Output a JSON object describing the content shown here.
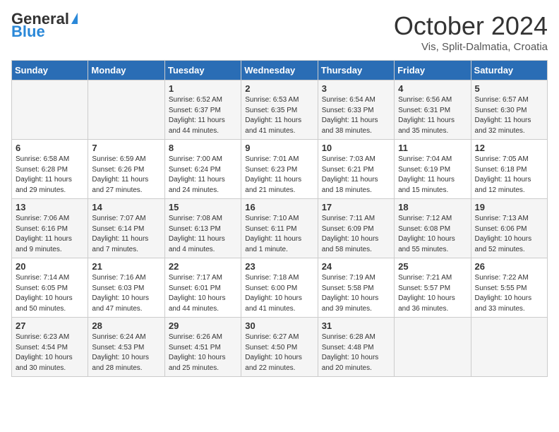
{
  "header": {
    "logo_general": "General",
    "logo_blue": "Blue",
    "month_title": "October 2024",
    "location": "Vis, Split-Dalmatia, Croatia"
  },
  "weekdays": [
    "Sunday",
    "Monday",
    "Tuesday",
    "Wednesday",
    "Thursday",
    "Friday",
    "Saturday"
  ],
  "weeks": [
    [
      {
        "day": "",
        "sunrise": "",
        "sunset": "",
        "daylight": ""
      },
      {
        "day": "",
        "sunrise": "",
        "sunset": "",
        "daylight": ""
      },
      {
        "day": "1",
        "sunrise": "Sunrise: 6:52 AM",
        "sunset": "Sunset: 6:37 PM",
        "daylight": "Daylight: 11 hours and 44 minutes."
      },
      {
        "day": "2",
        "sunrise": "Sunrise: 6:53 AM",
        "sunset": "Sunset: 6:35 PM",
        "daylight": "Daylight: 11 hours and 41 minutes."
      },
      {
        "day": "3",
        "sunrise": "Sunrise: 6:54 AM",
        "sunset": "Sunset: 6:33 PM",
        "daylight": "Daylight: 11 hours and 38 minutes."
      },
      {
        "day": "4",
        "sunrise": "Sunrise: 6:56 AM",
        "sunset": "Sunset: 6:31 PM",
        "daylight": "Daylight: 11 hours and 35 minutes."
      },
      {
        "day": "5",
        "sunrise": "Sunrise: 6:57 AM",
        "sunset": "Sunset: 6:30 PM",
        "daylight": "Daylight: 11 hours and 32 minutes."
      }
    ],
    [
      {
        "day": "6",
        "sunrise": "Sunrise: 6:58 AM",
        "sunset": "Sunset: 6:28 PM",
        "daylight": "Daylight: 11 hours and 29 minutes."
      },
      {
        "day": "7",
        "sunrise": "Sunrise: 6:59 AM",
        "sunset": "Sunset: 6:26 PM",
        "daylight": "Daylight: 11 hours and 27 minutes."
      },
      {
        "day": "8",
        "sunrise": "Sunrise: 7:00 AM",
        "sunset": "Sunset: 6:24 PM",
        "daylight": "Daylight: 11 hours and 24 minutes."
      },
      {
        "day": "9",
        "sunrise": "Sunrise: 7:01 AM",
        "sunset": "Sunset: 6:23 PM",
        "daylight": "Daylight: 11 hours and 21 minutes."
      },
      {
        "day": "10",
        "sunrise": "Sunrise: 7:03 AM",
        "sunset": "Sunset: 6:21 PM",
        "daylight": "Daylight: 11 hours and 18 minutes."
      },
      {
        "day": "11",
        "sunrise": "Sunrise: 7:04 AM",
        "sunset": "Sunset: 6:19 PM",
        "daylight": "Daylight: 11 hours and 15 minutes."
      },
      {
        "day": "12",
        "sunrise": "Sunrise: 7:05 AM",
        "sunset": "Sunset: 6:18 PM",
        "daylight": "Daylight: 11 hours and 12 minutes."
      }
    ],
    [
      {
        "day": "13",
        "sunrise": "Sunrise: 7:06 AM",
        "sunset": "Sunset: 6:16 PM",
        "daylight": "Daylight: 11 hours and 9 minutes."
      },
      {
        "day": "14",
        "sunrise": "Sunrise: 7:07 AM",
        "sunset": "Sunset: 6:14 PM",
        "daylight": "Daylight: 11 hours and 7 minutes."
      },
      {
        "day": "15",
        "sunrise": "Sunrise: 7:08 AM",
        "sunset": "Sunset: 6:13 PM",
        "daylight": "Daylight: 11 hours and 4 minutes."
      },
      {
        "day": "16",
        "sunrise": "Sunrise: 7:10 AM",
        "sunset": "Sunset: 6:11 PM",
        "daylight": "Daylight: 11 hours and 1 minute."
      },
      {
        "day": "17",
        "sunrise": "Sunrise: 7:11 AM",
        "sunset": "Sunset: 6:09 PM",
        "daylight": "Daylight: 10 hours and 58 minutes."
      },
      {
        "day": "18",
        "sunrise": "Sunrise: 7:12 AM",
        "sunset": "Sunset: 6:08 PM",
        "daylight": "Daylight: 10 hours and 55 minutes."
      },
      {
        "day": "19",
        "sunrise": "Sunrise: 7:13 AM",
        "sunset": "Sunset: 6:06 PM",
        "daylight": "Daylight: 10 hours and 52 minutes."
      }
    ],
    [
      {
        "day": "20",
        "sunrise": "Sunrise: 7:14 AM",
        "sunset": "Sunset: 6:05 PM",
        "daylight": "Daylight: 10 hours and 50 minutes."
      },
      {
        "day": "21",
        "sunrise": "Sunrise: 7:16 AM",
        "sunset": "Sunset: 6:03 PM",
        "daylight": "Daylight: 10 hours and 47 minutes."
      },
      {
        "day": "22",
        "sunrise": "Sunrise: 7:17 AM",
        "sunset": "Sunset: 6:01 PM",
        "daylight": "Daylight: 10 hours and 44 minutes."
      },
      {
        "day": "23",
        "sunrise": "Sunrise: 7:18 AM",
        "sunset": "Sunset: 6:00 PM",
        "daylight": "Daylight: 10 hours and 41 minutes."
      },
      {
        "day": "24",
        "sunrise": "Sunrise: 7:19 AM",
        "sunset": "Sunset: 5:58 PM",
        "daylight": "Daylight: 10 hours and 39 minutes."
      },
      {
        "day": "25",
        "sunrise": "Sunrise: 7:21 AM",
        "sunset": "Sunset: 5:57 PM",
        "daylight": "Daylight: 10 hours and 36 minutes."
      },
      {
        "day": "26",
        "sunrise": "Sunrise: 7:22 AM",
        "sunset": "Sunset: 5:55 PM",
        "daylight": "Daylight: 10 hours and 33 minutes."
      }
    ],
    [
      {
        "day": "27",
        "sunrise": "Sunrise: 6:23 AM",
        "sunset": "Sunset: 4:54 PM",
        "daylight": "Daylight: 10 hours and 30 minutes."
      },
      {
        "day": "28",
        "sunrise": "Sunrise: 6:24 AM",
        "sunset": "Sunset: 4:53 PM",
        "daylight": "Daylight: 10 hours and 28 minutes."
      },
      {
        "day": "29",
        "sunrise": "Sunrise: 6:26 AM",
        "sunset": "Sunset: 4:51 PM",
        "daylight": "Daylight: 10 hours and 25 minutes."
      },
      {
        "day": "30",
        "sunrise": "Sunrise: 6:27 AM",
        "sunset": "Sunset: 4:50 PM",
        "daylight": "Daylight: 10 hours and 22 minutes."
      },
      {
        "day": "31",
        "sunrise": "Sunrise: 6:28 AM",
        "sunset": "Sunset: 4:48 PM",
        "daylight": "Daylight: 10 hours and 20 minutes."
      },
      {
        "day": "",
        "sunrise": "",
        "sunset": "",
        "daylight": ""
      },
      {
        "day": "",
        "sunrise": "",
        "sunset": "",
        "daylight": ""
      }
    ]
  ]
}
